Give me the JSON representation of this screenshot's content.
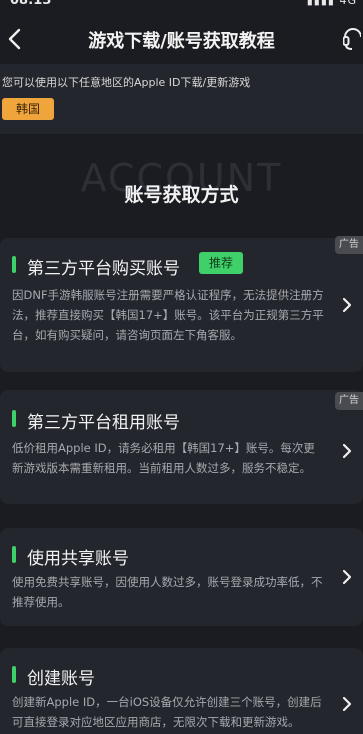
{
  "status_bar": {
    "time": "08:13",
    "signal": "4G"
  },
  "nav": {
    "title": "游戏下载/账号获取教程"
  },
  "notice": {
    "text": "您可以使用以下任意地区的Apple ID下载/更新游戏",
    "region": "韩国"
  },
  "section": {
    "watermark": "ACCOUNT",
    "title": "账号获取方式"
  },
  "ad_label": "广告",
  "cards": [
    {
      "title": "第三方平台购买账号",
      "tag": "推荐",
      "desc": "因DNF手游韩服账号注册需要严格认证程序，无法提供注册方法，推荐直接购买【韩国17+】账号。该平台为正规第三方平台，如有购买疑问，请咨询页面左下角客服。"
    },
    {
      "title": "第三方平台租用账号",
      "desc": "低价租用Apple ID，请务必租用【韩国17+】账号。每次更新游戏版本需重新租用。当前租用人数过多，服务不稳定。"
    },
    {
      "title": "使用共享账号",
      "desc": "使用免费共享账号，因使用人数过多，账号登录成功率低，不推荐使用。"
    },
    {
      "title": "创建账号",
      "desc": "创建新Apple ID，一台iOS设备仅允许创建三个账号，创建后可直接登录对应地区应用商店，无限次下载和更新游戏。"
    }
  ]
}
